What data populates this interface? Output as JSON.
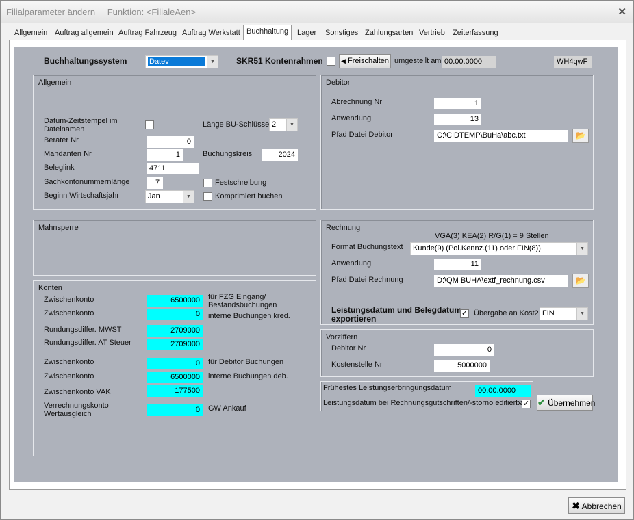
{
  "window": {
    "title": "Filialparameter ändern",
    "function_label": "Funktion: <FilialeAen>",
    "close_glyph": "✕"
  },
  "tabs": [
    {
      "label": "Allgemein"
    },
    {
      "label": "Auftrag allgemein"
    },
    {
      "label": "Auftrag Fahrzeug"
    },
    {
      "label": "Auftrag Werkstatt"
    },
    {
      "label": "Buchhaltung",
      "active": true
    },
    {
      "label": "Lager"
    },
    {
      "label": "Sonstiges"
    },
    {
      "label": "Zahlungsarten"
    },
    {
      "label": "Vertrieb"
    },
    {
      "label": "Zeiterfassung"
    }
  ],
  "top": {
    "system_label": "Buchhaltungssystem",
    "system_value": "Datev",
    "skr_label": "SKR51 Kontenrahmen",
    "freischalten": "Freischalten",
    "umgestellt_label": "umgestellt am",
    "umgestellt_value": "00.00.0000",
    "code": "WH4qwF"
  },
  "allgemein": {
    "title": "Allgemein",
    "datum_label": "Datum-Zeitstempel im Dateinamen",
    "laenge_label": "Länge BU-Schlüssel",
    "laenge_value": "2",
    "berater_label": "Berater Nr",
    "berater_value": "0",
    "mandanten_label": "Mandanten Nr",
    "mandanten_value": "1",
    "buchungskreis_label": "Buchungskreis",
    "buchungskreis_value": "2024",
    "beleglink_label": "Beleglink",
    "beleglink_value": "4711",
    "sachkonto_label": "Sachkontonummernlänge",
    "sachkonto_value": "7",
    "festschreibung_label": "Festschreibung",
    "beginn_label": "Beginn Wirtschaftsjahr",
    "beginn_value": "Jan",
    "komprimiert_label": "Komprimiert buchen"
  },
  "debitor": {
    "title": "Debitor",
    "abrechnung_label": "Abrechnung Nr",
    "abrechnung_value": "1",
    "anwendung_label": "Anwendung",
    "anwendung_value": "13",
    "pfad_label": "Pfad Datei Debitor",
    "pfad_value": "C:\\CIDTEMP\\BuHa\\abc.txt"
  },
  "mahnsperre": {
    "title": "Mahnsperre"
  },
  "rechnung": {
    "title": "Rechnung",
    "hint": "VGA(3) KEA(2) R/G(1)  = 9 Stellen",
    "format_label": "Format Buchungstext",
    "format_value": "Kunde(9) (Pol.Kennz.(11) oder FIN(8))",
    "anwendung_label": "Anwendung",
    "anwendung_value": "11",
    "pfad_label": "Pfad Datei Rechnung",
    "pfad_value": "D:\\QM BUHA\\extf_rechnung.csv",
    "leistung_label": "Leistungsdatum und Belegdatum exportieren",
    "uebergabe_label": "Übergabe an Kost2",
    "uebergabe_value": "FIN"
  },
  "konten": {
    "title": "Konten",
    "rows": [
      {
        "label": "Zwischenkonto",
        "value": "6500000",
        "note": "für FZG Eingang/ Bestandsbuchungen"
      },
      {
        "label": "Zwischenkonto",
        "value": "0",
        "note": "interne Buchungen kred."
      },
      {
        "label": "Rundungsdiffer. MWST",
        "value": "2709000",
        "note": ""
      },
      {
        "label": "Rundungsdiffer. AT Steuer",
        "value": "2709000",
        "note": ""
      },
      {
        "label": "Zwischenkonto",
        "value": "0",
        "note": "für Debitor Buchungen"
      },
      {
        "label": "Zwischenkonto",
        "value": "6500000",
        "note": "interne Buchungen deb."
      },
      {
        "label": "Zwischenkonto VAK",
        "value": "177500",
        "note": ""
      },
      {
        "label": "Verrechnungskonto Wertausgleich",
        "value": "0",
        "note": "GW Ankauf"
      }
    ]
  },
  "vorziffern": {
    "title": "Vorziffern",
    "debitor_label": "Debitor Nr",
    "debitor_value": "0",
    "kostenstelle_label": "Kostenstelle Nr",
    "kostenstelle_value": "5000000"
  },
  "leistung": {
    "fruehestes_label": "Frühestes Leistungserbringungsdatum",
    "fruehestes_value": "00.00.0000",
    "editierbar_label": "Leistungsdatum bei Rechnungsgutschriften/-storno editierbar"
  },
  "buttons": {
    "uebernehmen": "Übernehmen",
    "abbrechen": "Abbrechen"
  }
}
